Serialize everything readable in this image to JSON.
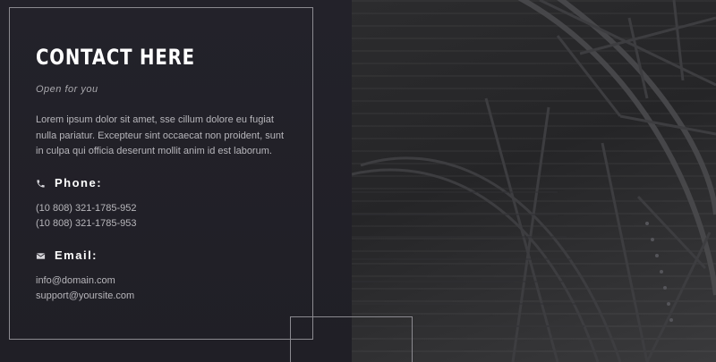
{
  "contact": {
    "title": "CONTACT HERE",
    "subtitle": "Open for you",
    "description": "Lorem ipsum dolor sit amet, sse cillum dolore eu fugiat nulla pariatur. Excepteur sint occaecat non proident, sunt in culpa qui officia deserunt mollit anim id est laborum.",
    "phone": {
      "icon": "phone-icon",
      "label": "Phone:",
      "numbers": [
        "(10 808) 321-1785-952",
        "(10 808) 321-1785-953"
      ]
    },
    "email": {
      "icon": "envelope-icon",
      "label": "Email:",
      "addresses": [
        "info@domain.com",
        "support@yoursite.com"
      ]
    }
  },
  "colors": {
    "panel": "#222127",
    "text": "#b7b6bb",
    "heading": "#ffffff",
    "frame": "#8b8a90"
  }
}
